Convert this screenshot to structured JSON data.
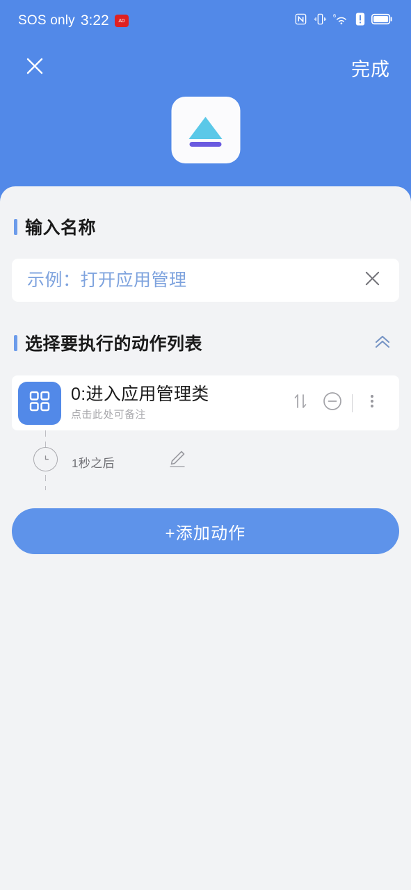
{
  "statusbar": {
    "carrier": "SOS only",
    "time": "3:22",
    "badge_label": "AD",
    "icons": [
      "nfc-icon",
      "vibrate-icon",
      "wifi-6-icon",
      "alert-icon",
      "battery-icon"
    ]
  },
  "navbar": {
    "close_icon": "close-icon",
    "done_label": "完成"
  },
  "app_icon": {
    "name": "eject-app-icon",
    "triangle_color": "#5BC8E8",
    "bar_color": "#6A5AE0",
    "background": "#FBFBFD"
  },
  "name_section": {
    "title": "输入名称",
    "input_value": "",
    "input_placeholder": "示例：打开应用管理",
    "clear_icon": "close-icon"
  },
  "actions_section": {
    "title": "选择要执行的动作列表",
    "collapse_icon": "double-chevron-up-icon",
    "items": [
      {
        "icon": "grid-apps-icon",
        "title": "0:进入应用管理类",
        "subtitle": "点击此处可备注",
        "reorder_icon": "sort-updown-icon",
        "remove_icon": "minus-circle-icon",
        "menu_icon": "more-vertical-icon",
        "delay_label": "1秒之后",
        "clock_icon": "clock-icon",
        "edit_icon": "pencil-icon"
      }
    ],
    "add_label": "+添加动作"
  },
  "colors": {
    "header_blue": "#5289E8",
    "body_gray": "#F2F3F5",
    "accent_bar": "#6C9BEA",
    "placeholder_blue": "#7EA3DE",
    "button_blue": "#5E93EA"
  }
}
